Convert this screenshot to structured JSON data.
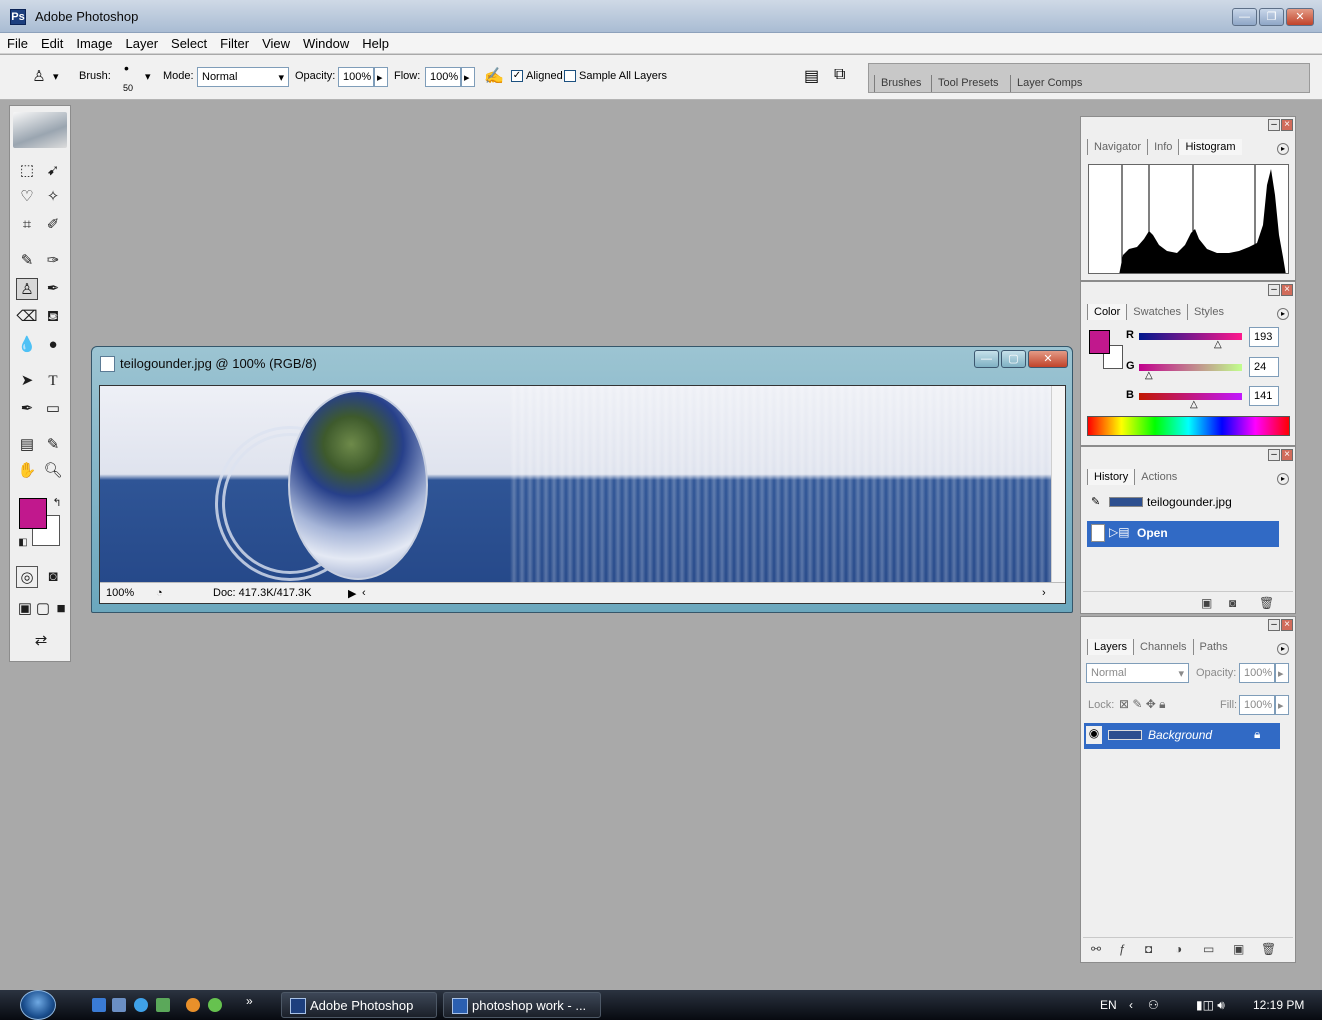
{
  "window": {
    "title": "Adobe Photoshop",
    "controls": [
      "—",
      "❐",
      "✕"
    ]
  },
  "menu": [
    "File",
    "Edit",
    "Image",
    "Layer",
    "Select",
    "Filter",
    "View",
    "Window",
    "Help"
  ],
  "options": {
    "brush_label": "Brush:",
    "brush_size": "50",
    "mode_label": "Mode:",
    "mode_value": "Normal",
    "opacity_label": "Opacity:",
    "opacity_value": "100%",
    "flow_label": "Flow:",
    "flow_value": "100%",
    "aligned_label": "Aligned",
    "aligned_checked": true,
    "sample_all_label": "Sample All Layers",
    "sample_all_checked": false,
    "well_tabs": [
      "Brushes",
      "Tool Presets",
      "Layer Comps"
    ]
  },
  "colors": {
    "foreground": "#c1188d",
    "background": "#ffffff",
    "selection": "#316ac5",
    "workspace": "#a9a9a9"
  },
  "document": {
    "title": "teilogounder.jpg @ 100% (RGB/8)",
    "zoom": "100%",
    "doc_size": "Doc: 417.3K/417.3K"
  },
  "navigator_panel": {
    "tabs": [
      "Navigator",
      "Info",
      "Histogram"
    ],
    "active_tab": "Histogram"
  },
  "color_panel": {
    "tabs": [
      "Color",
      "Swatches",
      "Styles"
    ],
    "active_tab": "Color",
    "channels": [
      {
        "label": "R",
        "value": "193"
      },
      {
        "label": "G",
        "value": "24"
      },
      {
        "label": "B",
        "value": "141"
      }
    ]
  },
  "history_panel": {
    "tabs": [
      "History",
      "Actions"
    ],
    "active_tab": "History",
    "snapshot": "teilogounder.jpg",
    "states": [
      "Open"
    ]
  },
  "layers_panel": {
    "tabs": [
      "Layers",
      "Channels",
      "Paths"
    ],
    "active_tab": "Layers",
    "blend_mode": "Normal",
    "opacity_label": "Opacity:",
    "opacity_value": "100%",
    "lock_label": "Lock:",
    "fill_label": "Fill:",
    "fill_value": "100%",
    "layers": [
      "Background"
    ]
  },
  "taskbar": {
    "buttons": [
      "Adobe Photoshop",
      "photoshop work - ..."
    ],
    "language": "EN",
    "clock": "12:19 PM"
  }
}
